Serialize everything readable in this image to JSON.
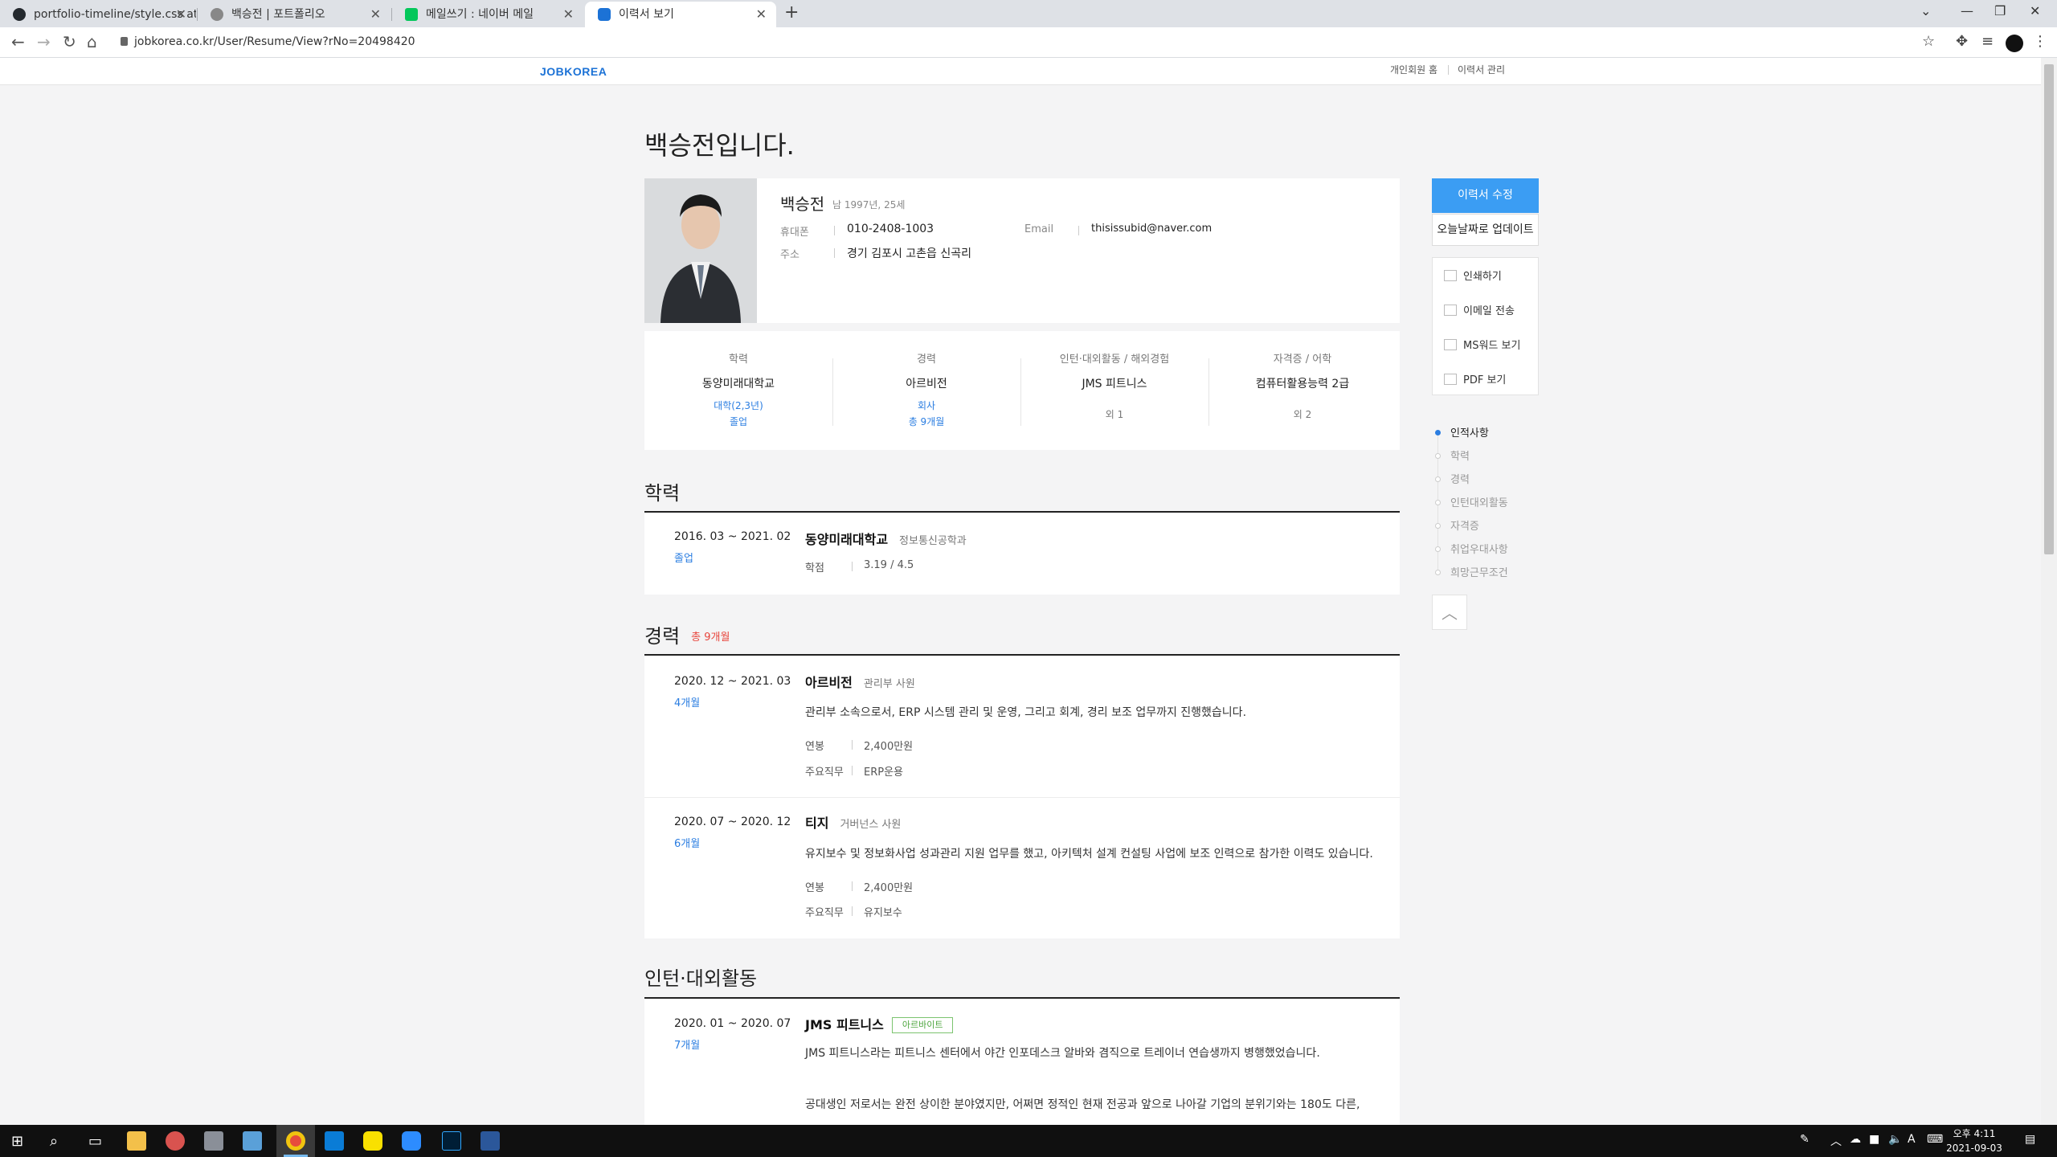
{
  "browser": {
    "tabs": [
      {
        "label": "portfolio-timeline/style.css at m",
        "icon": "github-icon",
        "color": "#24292e"
      },
      {
        "label": "백승전 | 포트폴리오",
        "icon": "page-icon",
        "color": "#888888"
      },
      {
        "label": "메일쓰기 : 네이버 메일",
        "icon": "naver-icon",
        "color": "#03c75a"
      },
      {
        "label": "이력서 보기",
        "icon": "jobkorea-icon",
        "color": "#1c72d6"
      }
    ],
    "url": "jobkorea.co.kr/User/Resume/View?rNo=20498420"
  },
  "site": {
    "logo": "JOBKOREA",
    "links": [
      "개인회원 홈",
      "이력서 관리"
    ]
  },
  "resume": {
    "title": "백승전입니다.",
    "profile": {
      "name": "백승전",
      "meta": "남  1997년, 25세",
      "phone_label": "휴대폰",
      "phone": "010-2408-1003",
      "email_label": "Email",
      "email": "thisissubid@naver.com",
      "address_label": "주소",
      "address": "경기 김포시 고촌읍 신곡리"
    },
    "summary": [
      {
        "title": "학력",
        "main": "동양미래대학교",
        "sub1": "대학(2,3년)",
        "sub2": "졸업"
      },
      {
        "title": "경력",
        "main": "아르비전",
        "sub1": "회사",
        "sub2": "총 9개월"
      },
      {
        "title": "인턴·대외활동 / 해외경험",
        "main": "JMS 피트니스",
        "extra": "외 1"
      },
      {
        "title": "자격증 / 어학",
        "main": "컴퓨터활용능력 2급",
        "extra": "외 2"
      }
    ],
    "education": {
      "heading": "학력",
      "items": [
        {
          "period": "2016. 03 ~ 2021. 02",
          "status": "졸업",
          "school": "동양미래대학교",
          "major": "정보통신공학과",
          "gpa_label": "학점",
          "gpa": "3.19 / 4.5"
        }
      ]
    },
    "career": {
      "heading": "경력",
      "total": "총 9개월",
      "items": [
        {
          "period": "2020. 12 ~ 2021. 03",
          "duration": "4개월",
          "company": "아르비전",
          "position": "관리부 사원",
          "desc": "관리부 소속으로서, ERP 시스템 관리 및 운영, 그리고 회계, 경리 보조 업무까지 진행했습니다.",
          "salary_label": "연봉",
          "salary": "2,400만원",
          "duty_label": "주요직무",
          "duty": "ERP운용"
        },
        {
          "period": "2020. 07 ~ 2020. 12",
          "duration": "6개월",
          "company": "티지",
          "position": "거버넌스 사원",
          "desc": "유지보수 및 정보화사업 성과관리 지원 업무를 했고, 아키텍처 설계 컨설팅 사업에 보조 인력으로 참가한 이력도 있습니다.",
          "salary_label": "연봉",
          "salary": "2,400만원",
          "duty_label": "주요직무",
          "duty": "유지보수"
        }
      ]
    },
    "activities": {
      "heading": "인턴·대외활동",
      "items": [
        {
          "period": "2020. 01 ~ 2020. 07",
          "duration": "7개월",
          "org": "JMS 피트니스",
          "tag": "아르바이트",
          "desc": "JMS 피트니스라는 피트니스 센터에서 야간 인포데스크 알바와 겸직으로 트레이너 연습생까지 병행했었습니다.",
          "desc2": "공대생인 저로서는 완전 상이한 분야였지만, 어쩌면 정적인 현재 전공과 앞으로 나아갈 기업의 분위기와는 180도 다른,"
        }
      ]
    }
  },
  "sidebar": {
    "edit_button": "이력서 수정",
    "update_button": "오늘날짜로 업데이트",
    "actions": [
      "인쇄하기",
      "이메일 전송",
      "MS워드 보기",
      "PDF 보기"
    ],
    "toc": [
      "인적사항",
      "학력",
      "경력",
      "인턴대외활동",
      "자격증",
      "취업우대사항",
      "희망근무조건"
    ]
  },
  "taskbar": {
    "time": "오후 4:11",
    "date": "2021-09-03",
    "ime": "A"
  }
}
